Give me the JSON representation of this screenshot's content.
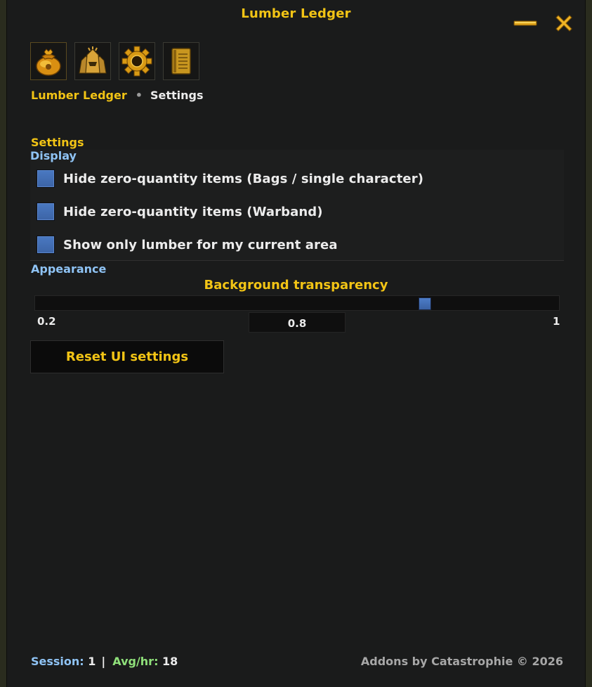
{
  "window": {
    "title": "Lumber Ledger",
    "minimize_icon": "minimize-icon",
    "close_icon": "close-icon"
  },
  "tabs": [
    {
      "icon": "money-bag-icon",
      "active": true
    },
    {
      "icon": "warband-helmets-icon",
      "active": false
    },
    {
      "icon": "gear-icon",
      "active": false
    },
    {
      "icon": "notes-icon",
      "active": false
    }
  ],
  "breadcrumb": {
    "home": "Lumber Ledger",
    "separator": "•",
    "current": "Settings"
  },
  "settings": {
    "title": "Settings",
    "display": {
      "title": "Display",
      "options": [
        {
          "label": "Hide zero-quantity items (Bags / single character)",
          "checked": false
        },
        {
          "label": "Hide zero-quantity items (Warband)",
          "checked": false
        },
        {
          "label": "Show only lumber for my current area",
          "checked": false
        }
      ]
    },
    "appearance": {
      "title": "Appearance",
      "slider": {
        "label": "Background transparency",
        "min": "0.2",
        "max": "1",
        "value": "0.8",
        "value_num": 0.8,
        "min_num": 0.2,
        "max_num": 1
      }
    },
    "reset_label": "Reset UI settings"
  },
  "footer": {
    "session_label": "Session:",
    "session_value": "1",
    "separator": "|",
    "avg_label": "Avg/hr:",
    "avg_value": "18",
    "credit": "Addons by Catastrophie © 2026"
  },
  "colors": {
    "accent_gold": "#f2c415",
    "section_blue": "#8fc3f4",
    "avg_green": "#8fe07a",
    "checkbox_blue": "#4a79c2",
    "panel_bg": "#1a1b1b"
  }
}
